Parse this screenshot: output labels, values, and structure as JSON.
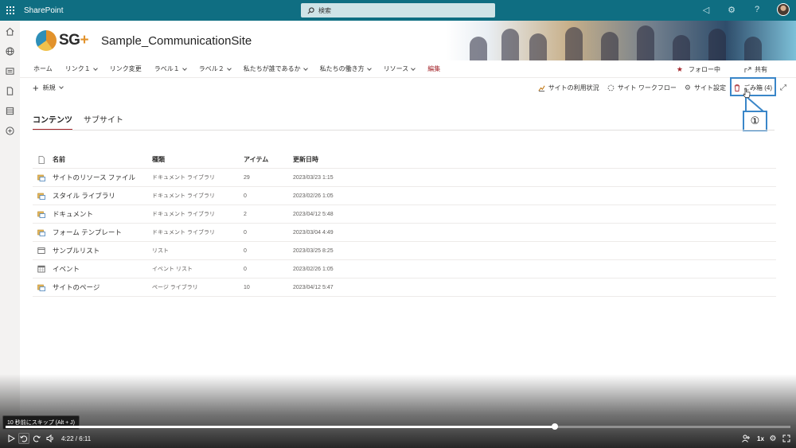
{
  "suitebar": {
    "app_name": "SharePoint",
    "search_placeholder": "検索"
  },
  "header": {
    "logo_text": "SG",
    "logo_plus": "+",
    "site_title": "Sample_CommunicationSite"
  },
  "topnav": {
    "items": [
      {
        "label": "ホーム",
        "chevron": false
      },
      {
        "label": "リンク１",
        "chevron": true
      },
      {
        "label": "リンク変更",
        "chevron": false
      },
      {
        "label": "ラベル１",
        "chevron": true
      },
      {
        "label": "ラベル２",
        "chevron": true
      },
      {
        "label": "私たちが誰であるか",
        "chevron": true
      },
      {
        "label": "私たちの働き方",
        "chevron": true
      },
      {
        "label": "リソース",
        "chevron": true
      }
    ],
    "edit_label": "編集",
    "follow_label": "フォロー中",
    "share_label": "共有"
  },
  "cmdbar": {
    "new_label": "新規",
    "usage_label": "サイトの利用状況",
    "workflow_label": "サイト ワークフロー",
    "settings_label": "サイト設定",
    "recycle_label": "ごみ箱 (4)"
  },
  "annotation": {
    "callout": "①"
  },
  "tabs": {
    "contents": "コンテンツ",
    "subsites": "サブサイト"
  },
  "table": {
    "headers": {
      "name": "名前",
      "type": "種類",
      "items": "アイテム",
      "modified": "更新日時"
    },
    "rows": [
      {
        "icon": "library-icon",
        "name": "サイトのリソース ファイル",
        "type": "ドキュメント ライブラリ",
        "items": "29",
        "modified": "2023/03/23 1:15"
      },
      {
        "icon": "library-icon",
        "name": "スタイル ライブラリ",
        "type": "ドキュメント ライブラリ",
        "items": "0",
        "modified": "2023/02/26 1:05"
      },
      {
        "icon": "library-icon",
        "name": "ドキュメント",
        "type": "ドキュメント ライブラリ",
        "items": "2",
        "modified": "2023/04/12 5:48"
      },
      {
        "icon": "library-icon",
        "name": "フォーム テンプレート",
        "type": "ドキュメント ライブラリ",
        "items": "0",
        "modified": "2023/03/04 4:49"
      },
      {
        "icon": "list-icon",
        "name": "サンプルリスト",
        "type": "リスト",
        "items": "0",
        "modified": "2023/03/25 8:25"
      },
      {
        "icon": "calendar-icon",
        "name": "イベント",
        "type": "イベント リスト",
        "items": "0",
        "modified": "2023/02/26 1:05"
      },
      {
        "icon": "library-icon",
        "name": "サイトのページ",
        "type": "ページ ライブラリ",
        "items": "10",
        "modified": "2023/04/12 5:47"
      }
    ]
  },
  "video": {
    "tooltip": "10 秒前にスキップ (Alt + J)",
    "time": "4:22 / 6:11",
    "progress": 0.7,
    "speed": "1x"
  },
  "colors": {
    "suitebar": "#0f6e82",
    "accent": "#a4262c",
    "annotation": "#3a86c8"
  }
}
